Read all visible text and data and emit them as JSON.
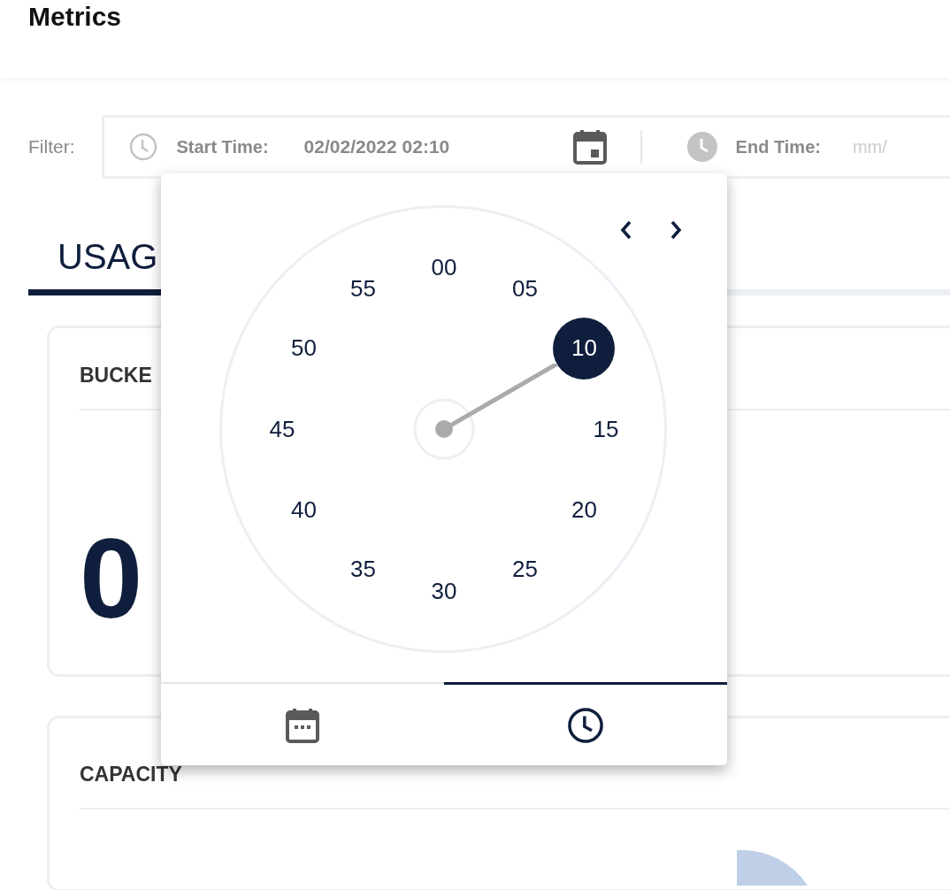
{
  "header": {
    "title": "Metrics"
  },
  "filter": {
    "label": "Filter:",
    "start": {
      "label": "Start Time:",
      "value": "02/02/2022 02:10"
    },
    "end": {
      "label": "End Time:",
      "placeholder": "mm/"
    }
  },
  "tabs": [
    {
      "label": "USAG",
      "selected": true
    }
  ],
  "cards": [
    {
      "title": "BUCKE",
      "value": "0"
    },
    {
      "title": "CAPACITY"
    }
  ],
  "picker": {
    "minutes": [
      {
        "label": "00",
        "selected": false
      },
      {
        "label": "05",
        "selected": false
      },
      {
        "label": "10",
        "selected": true
      },
      {
        "label": "15",
        "selected": false
      },
      {
        "label": "20",
        "selected": false
      },
      {
        "label": "25",
        "selected": false
      },
      {
        "label": "30",
        "selected": false
      },
      {
        "label": "35",
        "selected": false
      },
      {
        "label": "40",
        "selected": false
      },
      {
        "label": "45",
        "selected": false
      },
      {
        "label": "50",
        "selected": false
      },
      {
        "label": "55",
        "selected": false
      }
    ],
    "views": [
      {
        "kind": "date",
        "selected": false
      },
      {
        "kind": "time",
        "selected": true
      }
    ]
  }
}
